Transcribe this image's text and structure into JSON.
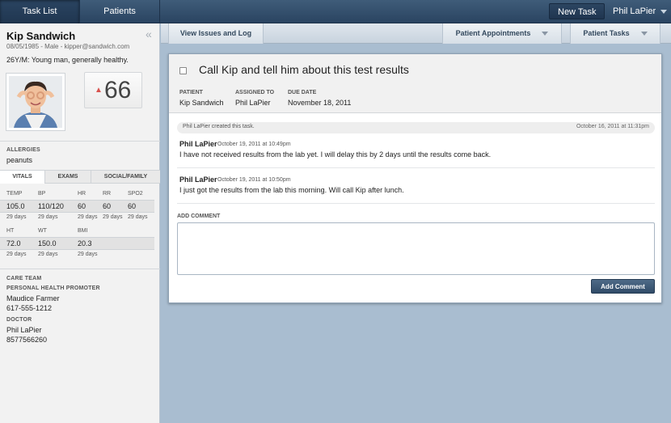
{
  "topbar": {
    "tabs": [
      {
        "label": "Task List",
        "active": true
      },
      {
        "label": "Patients",
        "active": false
      }
    ],
    "new_task_label": "New Task",
    "user_name": "Phil LaPier"
  },
  "patient": {
    "name": "Kip Sandwich",
    "info": "08/05/1985 - Male - kipper@sandwich.com",
    "summary": "26Y/M: Young man, generally healthy.",
    "score": "66",
    "score_trend": "up"
  },
  "allergies": {
    "label": "ALLERGIES",
    "value": "peanuts"
  },
  "vitals_tabs": [
    {
      "label": "VITALS",
      "active": true
    },
    {
      "label": "EXAMS",
      "active": false
    },
    {
      "label": "SOCIAL/FAMILY",
      "active": false
    }
  ],
  "vitals": {
    "row1": [
      {
        "label": "TEMP",
        "value": "105.0",
        "age": "29 days"
      },
      {
        "label": "BP",
        "value": "110/120",
        "age": "29 days"
      },
      {
        "label": "HR",
        "value": "60",
        "age": "29 days"
      },
      {
        "label": "RR",
        "value": "60",
        "age": "29 days"
      },
      {
        "label": "SPO2",
        "value": "60",
        "age": "29 days"
      }
    ],
    "row2": [
      {
        "label": "HT",
        "value": "72.0",
        "age": "29 days"
      },
      {
        "label": "WT",
        "value": "150.0",
        "age": "29 days"
      },
      {
        "label": "BMI",
        "value": "20.3",
        "age": "29 days"
      }
    ]
  },
  "care_team": {
    "label": "CARE TEAM",
    "promoter_label": "PERSONAL HEALTH PROMOTER",
    "promoter_name": "Maudice Farmer",
    "promoter_phone": "617-555-1212",
    "doctor_label": "DOCTOR",
    "doctor_name": "Phil LaPier",
    "doctor_phone": "8577566260"
  },
  "subnav": {
    "issues_label": "View Issues and Log",
    "appointments_label": "Patient Appointments",
    "tasks_label": "Patient Tasks"
  },
  "task": {
    "title": "Call Kip and tell him about this test results",
    "patient_label": "PATIENT",
    "patient_value": "Kip Sandwich",
    "assigned_label": "ASSIGNED TO",
    "assigned_value": "Phil LaPier",
    "due_label": "DUE DATE",
    "due_value": "November 18, 2011",
    "created_note": "Phil LaPier created this task.",
    "created_time": "October 16, 2011 at 11:31pm",
    "comments": [
      {
        "author": "Phil LaPier",
        "time": "October 19, 2011 at 10:49pm",
        "body": "I have not received results from the lab yet. I will delay this by 2 days until the results come back."
      },
      {
        "author": "Phil LaPier",
        "time": "October 19, 2011 at 10:50pm",
        "body": "I just got the results from the lab this morning. Will call Kip after lunch."
      }
    ],
    "add_comment_label": "ADD COMMENT",
    "add_comment_button": "Add Comment",
    "add_comment_value": ""
  },
  "colors": {
    "topbar": "#2f4a67",
    "background": "#a9bdd0",
    "button": "#3e5a77",
    "trend_up": "#d9534f"
  }
}
